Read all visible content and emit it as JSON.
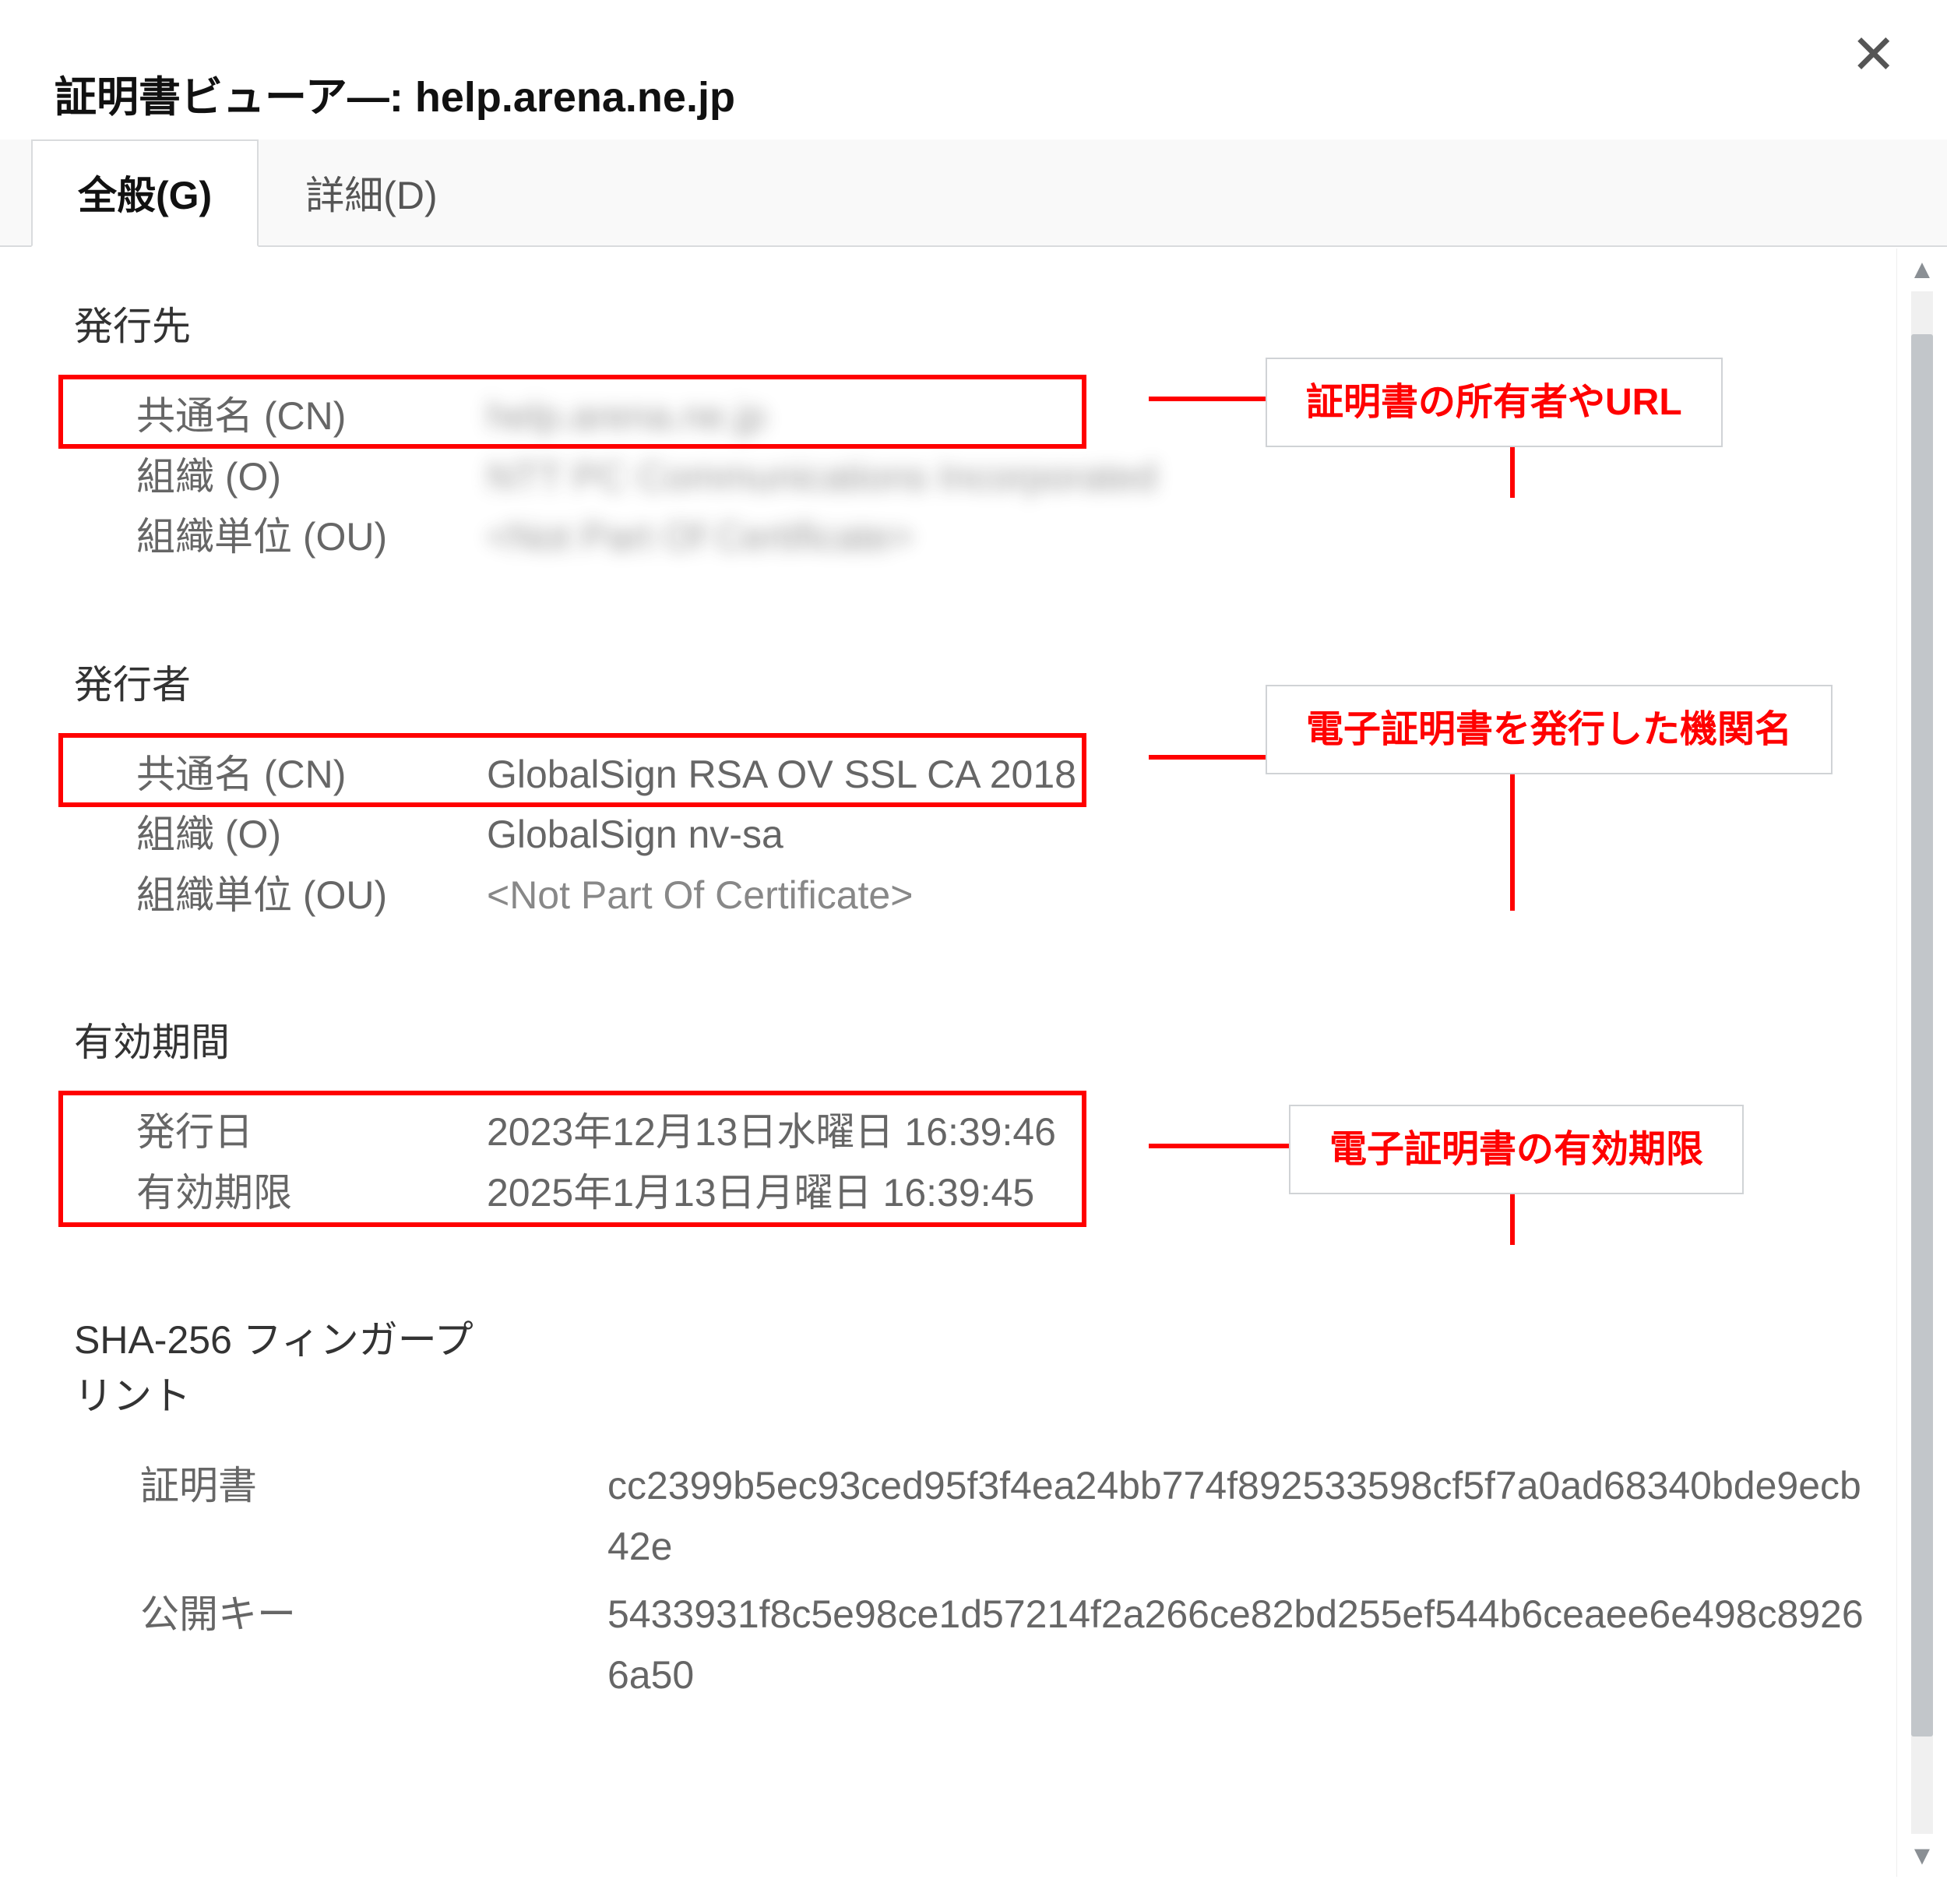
{
  "window": {
    "title_prefix": "証明書ビューア―: ",
    "domain": "help.arena.ne.jp"
  },
  "tabs": {
    "general": "全般(G)",
    "details": "詳細(D)"
  },
  "issued_to": {
    "heading": "発行先",
    "cn_label": "共通名 (CN)",
    "cn_value": "help.arena.ne.jp",
    "o_label": "組織 (O)",
    "o_value": "NTT PC Communications Incorporated",
    "ou_label": "組織単位 (OU)",
    "ou_value": "<Not Part Of Certificate>"
  },
  "issuer": {
    "heading": "発行者",
    "cn_label": "共通名 (CN)",
    "cn_value": "GlobalSign RSA OV SSL CA 2018",
    "o_label": "組織 (O)",
    "o_value": "GlobalSign nv-sa",
    "ou_label": "組織単位 (OU)",
    "ou_value": "<Not Part Of Certificate>"
  },
  "validity": {
    "heading": "有効期間",
    "issued_label": "発行日",
    "issued_value": "2023年12月13日水曜日 16:39:46",
    "expires_label": "有効期限",
    "expires_value": "2025年1月13日月曜日 16:39:45"
  },
  "fingerprints": {
    "heading": "SHA-256 フィンガープリント",
    "cert_label": "証明書",
    "cert_value": "cc2399b5ec93ced95f3f4ea24bb774f892533598cf5f7a0ad68340bde9ecb42e",
    "pubkey_label": "公開キー",
    "pubkey_value": "5433931f8c5e98ce1d57214f2a266ce82bd255ef544b6ceaee6e498c89266a50"
  },
  "annotations": {
    "owner": "証明書の所有者やURL",
    "issuer": "電子証明書を発行した機関名",
    "validity": "電子証明書の有効期限"
  }
}
